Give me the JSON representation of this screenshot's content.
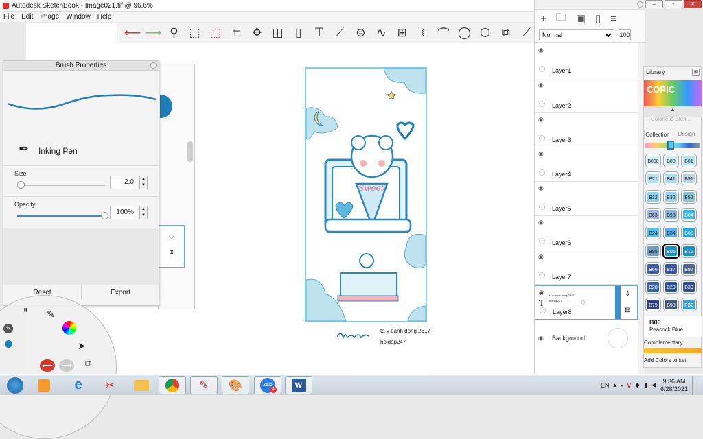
{
  "window": {
    "title": "Autodesk SketchBook - Image021.tif @ 96.6%",
    "controls": [
      "–",
      "▫",
      "✕"
    ]
  },
  "menu": [
    "File",
    "Edit",
    "Image",
    "Window",
    "Help"
  ],
  "toolbar": {
    "icons": [
      "undo-icon",
      "redo-icon",
      "zoom-icon",
      "rect-select-icon",
      "lasso-select-icon",
      "crop-icon",
      "transform-icon",
      "distort-icon",
      "fill-icon",
      "text-icon",
      "ruler-icon",
      "ellipse-guide-icon",
      "french-curve-icon",
      "perspective-icon",
      "symmetry-icon",
      "stroke-icon",
      "circle-icon",
      "shape-icon",
      "copy-icon",
      "more-icon"
    ]
  },
  "brush": {
    "title": "Brush Properties",
    "name": "Inking Pen",
    "size_label": "Size",
    "size_value": "2.0",
    "size_fraction": 0.0,
    "opacity_label": "Opacity",
    "opacity_value": "100%",
    "opacity_fraction": 1.0,
    "reset": "Reset",
    "export": "Export",
    "stroke_color": "#1c7fb8"
  },
  "layers": {
    "blend_mode": "Normal",
    "opacity": "100",
    "items": [
      {
        "name": "Layer1"
      },
      {
        "name": "Layer2"
      },
      {
        "name": "Layer3"
      },
      {
        "name": "Layer4"
      },
      {
        "name": "Layer5"
      },
      {
        "name": "Layer6"
      },
      {
        "name": "Layer7"
      },
      {
        "name": "Layer8",
        "selected": true,
        "thumb_text1": "ta y danh dong 2617",
        "thumb_text2": "hoidap247"
      },
      {
        "name": "Background"
      }
    ]
  },
  "library": {
    "title": "Library",
    "brand": "COPIC",
    "colorless": "Colorless Blen...",
    "tabs": [
      "Collection",
      "Design"
    ],
    "swatches": [
      {
        "code": "B\n000",
        "color": "#d7f1f5"
      },
      {
        "code": "B00",
        "color": "#cdeef3"
      },
      {
        "code": "B01",
        "color": "#b7e6f1"
      },
      {
        "code": "B21",
        "color": "#b8dff1"
      },
      {
        "code": "B41",
        "color": "#b0dcef"
      },
      {
        "code": "B91",
        "color": "#bcd3e4"
      },
      {
        "code": "B12",
        "color": "#8fd1ec"
      },
      {
        "code": "B32",
        "color": "#9dd3ee"
      },
      {
        "code": "B52",
        "color": "#8cc2cf"
      },
      {
        "code": "B63",
        "color": "#a2b7d8"
      },
      {
        "code": "B93",
        "color": "#8fb7d9"
      },
      {
        "code": "B04",
        "color": "#3fb8e3"
      },
      {
        "code": "B24",
        "color": "#56bce8"
      },
      {
        "code": "B34",
        "color": "#5aaee4"
      },
      {
        "code": "B05",
        "color": "#29a6dc"
      },
      {
        "code": "B95",
        "color": "#6f9cc7"
      },
      {
        "code": "B06",
        "color": "#1295d2"
      },
      {
        "code": "B16",
        "color": "#0c93d0"
      },
      {
        "code": "B66",
        "color": "#3f5fa9"
      },
      {
        "code": "B37",
        "color": "#3b56a5"
      },
      {
        "code": "B97",
        "color": "#4b6c96"
      },
      {
        "code": "B28",
        "color": "#2f63b0"
      },
      {
        "code": "B29",
        "color": "#2353a8"
      },
      {
        "code": "B39",
        "color": "#2e4d9a"
      },
      {
        "code": "B79",
        "color": "#2f3e8b"
      },
      {
        "code": "B99",
        "color": "#3f5a80"
      },
      {
        "code": "FB2",
        "color": "#2ca4e0"
      }
    ],
    "selected_code": "B06",
    "selected_name": "Peacock Blue",
    "complementary": "Complementary",
    "footer": "Add Colors to set"
  },
  "artwork": {
    "signature_text1": "ta y danh dong 2617",
    "signature_text2": "hoidap247",
    "card_word": "Sweet"
  },
  "taskbar": {
    "lang": "EN",
    "time": "9:36 AM",
    "date": "6/28/2021",
    "zalo_badge": "4",
    "apps": [
      "start-icon",
      "media-icon",
      "ie-icon",
      "snip-icon",
      "explorer-icon",
      "chrome-icon",
      "sketchbook-icon",
      "paint-icon",
      "zalo-icon",
      "word-icon"
    ]
  }
}
